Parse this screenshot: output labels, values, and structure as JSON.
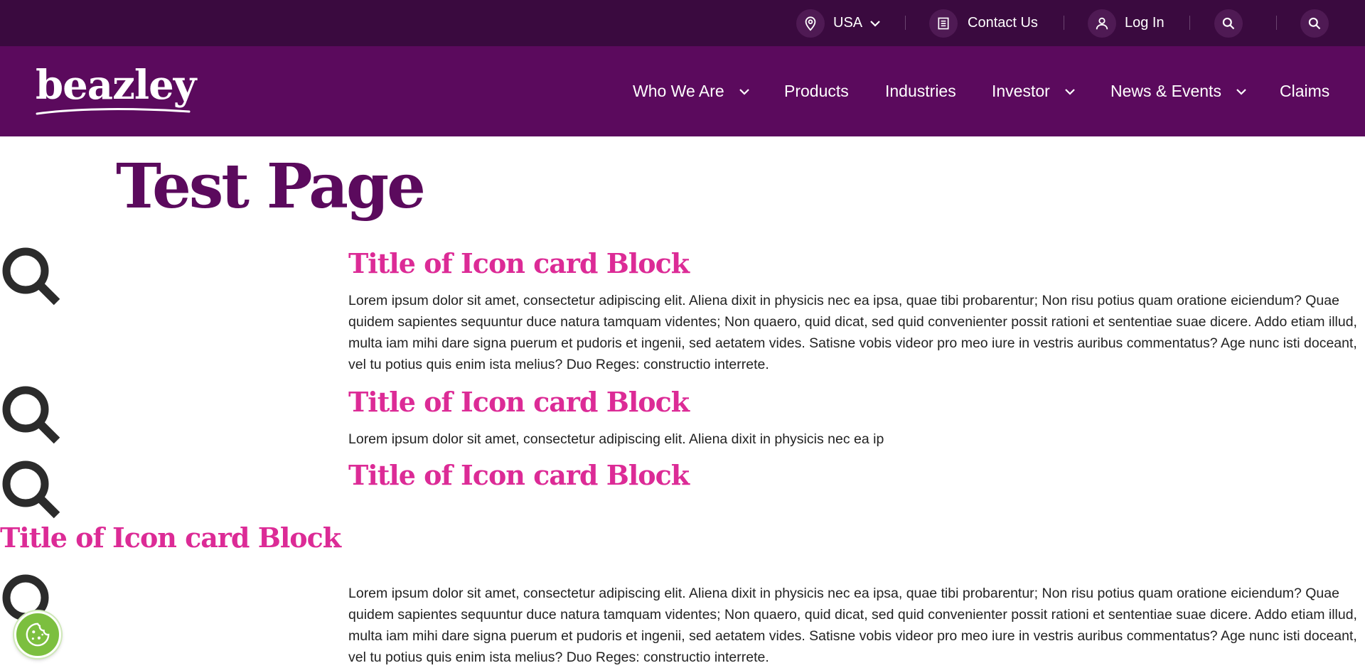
{
  "utility_bar": {
    "country_label": "USA",
    "contact_label": "Contact Us",
    "login_label": "Log In"
  },
  "brand": {
    "logo_text": "beazley"
  },
  "nav": {
    "items": [
      {
        "label": "Who We Are",
        "has_dropdown": true
      },
      {
        "label": "Products",
        "has_dropdown": false
      },
      {
        "label": "Industries",
        "has_dropdown": false
      },
      {
        "label": "Investor",
        "has_dropdown": true
      },
      {
        "label": "News & Events",
        "has_dropdown": true
      },
      {
        "label": "Claims",
        "has_dropdown": false
      }
    ]
  },
  "page": {
    "title": "Test Page"
  },
  "cards": [
    {
      "title": "Title of Icon card Block",
      "icon": "search-icon",
      "body": "Lorem ipsum dolor sit amet, consectetur adipiscing elit. Aliena dixit in physicis nec ea ipsa, quae tibi probarentur; Non risu potius quam oratione eiciendum? Quae quidem sapientes sequuntur duce natura tamquam videntes; Non quaero, quid dicat, sed quid convenienter possit rationi et sententiae suae dicere. Addo etiam illud, multa iam mihi dare signa puerum et pudoris et ingenii, sed aetatem vides. Satisne vobis videor pro meo iure in vestris auribus commentatus? Age nunc isti doceant, vel tu potius quis enim ista melius? Duo Reges: constructio interrete."
    },
    {
      "title": "Title of Icon card Block",
      "icon": "search-icon",
      "body": "Lorem ipsum dolor sit amet, consectetur adipiscing elit. Aliena dixit in physicis nec ea ip"
    },
    {
      "title": "Title of Icon card Block",
      "icon": "search-icon",
      "body": ""
    },
    {
      "title": "Title of Icon card Block",
      "icon": "search-icon",
      "body": "Lorem ipsum dolor sit amet, consectetur adipiscing elit. Aliena dixit in physicis nec ea ipsa, quae tibi probarentur; Non risu potius quam oratione eiciendum? Quae quidem sapientes sequuntur duce natura tamquam videntes; Non quaero, quid dicat, sed quid convenienter possit rationi et sententiae suae dicere. Addo etiam illud, multa iam mihi dare signa puerum et pudoris et ingenii, sed aetatem vides. Satisne vobis videor pro meo iure in vestris auribus commentatus? Age nunc isti doceant, vel tu potius quis enim ista melius? Duo Reges: constructio interrete."
    }
  ],
  "colors": {
    "top_bar": "#3a0a3f",
    "nav_bar": "#5b0a5d",
    "page_title": "#5b0a5d",
    "card_title": "#dc2b96",
    "cookie_button": "#7cbf3f"
  }
}
